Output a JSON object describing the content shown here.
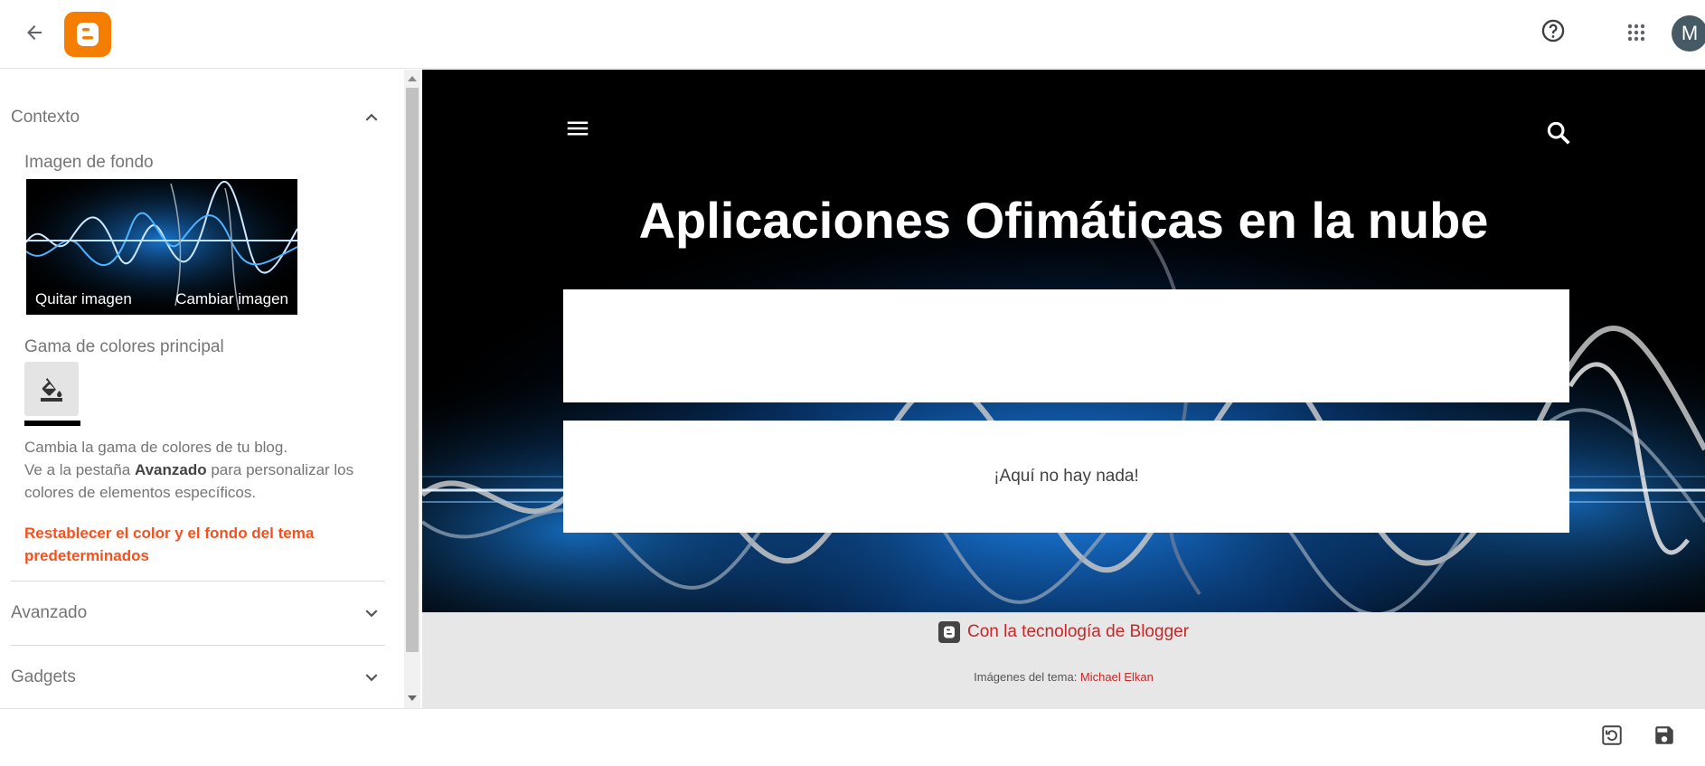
{
  "app": {
    "avatar_letter": "M",
    "brand_color": "#f57d00"
  },
  "sidebar": {
    "section_context": "Contexto",
    "background_image_label": "Imagen de fondo",
    "remove_image": "Quitar imagen",
    "change_image": "Cambiar imagen",
    "main_palette_label": "Gama de colores principal",
    "help_line1": "Cambia la gama de colores de tu blog.",
    "help_line2_prefix": "Ve a la pestaña ",
    "help_line2_bold": "Avanzado",
    "help_line2_suffix": " para personalizar los colores de elementos específicos.",
    "reset_link": "Restablecer el color y el fondo del tema predeterminados",
    "section_advanced": "Avanzado",
    "section_gadgets": "Gadgets",
    "accent_link_color": "#f4511e"
  },
  "preview": {
    "blog_title": "Aplicaciones Ofimáticas en la nube",
    "empty_message": "¡Aquí no hay nada!",
    "powered_by": "Con la tecnología de Blogger",
    "credit_prefix": "Imágenes del tema: ",
    "credit_author": "Michael Elkan",
    "link_color": "#c62828"
  }
}
